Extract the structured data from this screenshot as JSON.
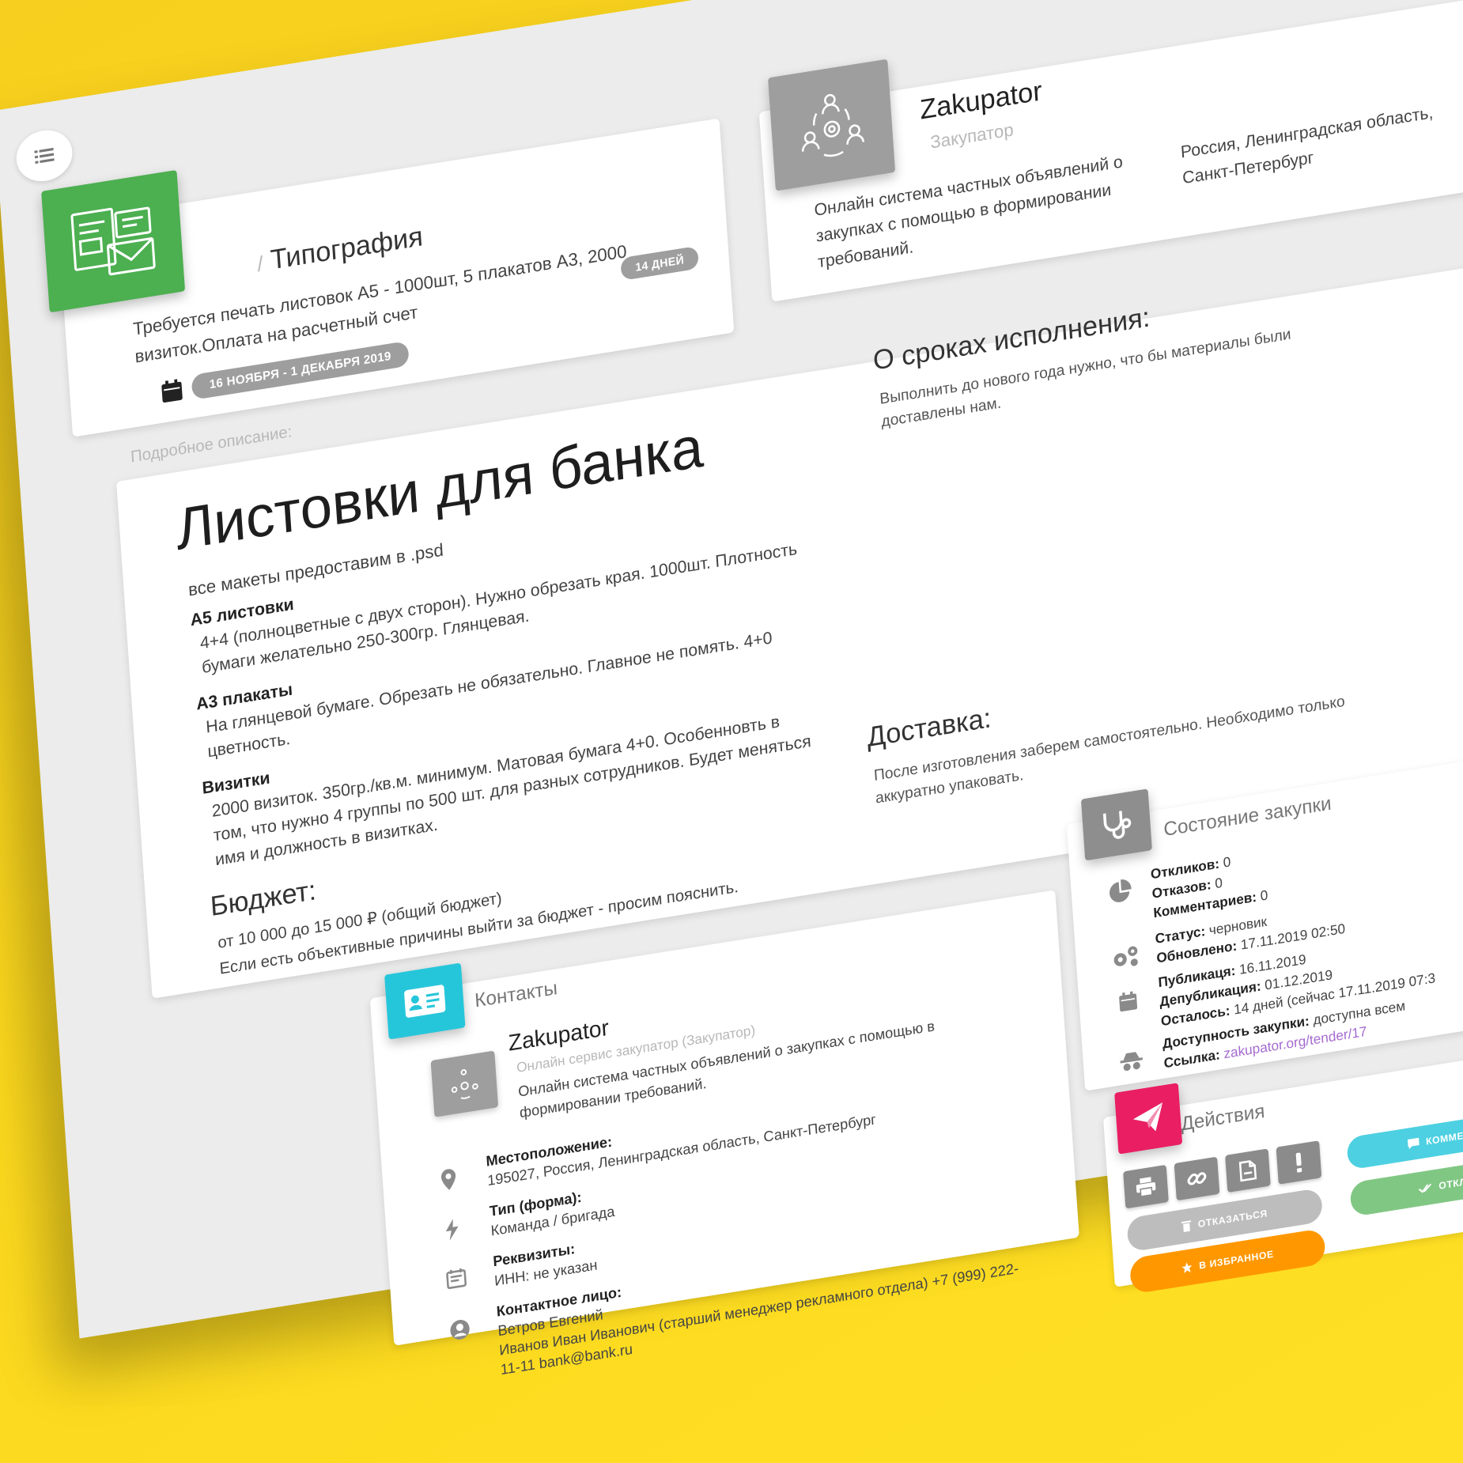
{
  "category_card": {
    "slash": "/",
    "category": "Типография",
    "description": "Требуется печать листовок А5 - 1000шт, 5 плакатов А3, 2000 визиток.Оплата на расчетный счет",
    "days_badge": "14 ДНЕЙ",
    "date_range": "16 НОЯБРЯ - 1 ДЕКАБРЯ 2019",
    "accent": "#4caf50"
  },
  "customer_card": {
    "name": "Zakupator",
    "subtitle": "Закупатор",
    "description": "Онлайн система частных объявлений о закупках с помощью в формировании требований.",
    "location_line1": "Россия, Ленинградская область,",
    "location_line2": "Санкт-Петербург"
  },
  "detail": {
    "section_label": "Подробное описание:",
    "title": "Листовки для банка",
    "intro": "все макеты предоставим в .psd",
    "items": [
      {
        "heading": "А5 листовки",
        "text": "4+4 (полноцветные с двух сторон). Нужно обрезать края. 1000шт. Плотность бумаги желательно 250-300гр. Глянцевая."
      },
      {
        "heading": "А3 плакаты",
        "text": "На глянцевой бумаге. Обрезать не обязательно. Главное не помять. 4+0 цветность."
      },
      {
        "heading": "Визитки",
        "text": "2000 визиток. 350гр./кв.м. минимум. Матовая бумага 4+0. Особенновть в том, что нужно 4 группы по 500 шт. для разных сотрудников. Будет меняться имя и должность в визитках."
      }
    ],
    "budget_heading": "Бюджет:",
    "budget_value": "от 10 000 до 15 000 ₽ (общий бюджет)",
    "budget_note": "Если есть объективные причины выйти за бюджет - просим пояснить.",
    "terms_heading": "О сроках исполнения:",
    "terms_text": "Выполнить до нового года нужно, что бы материалы были доставлены нам.",
    "delivery_heading": "Доставка:",
    "delivery_text": "После изготовления заберем самостоятельно. Необходимо только аккуратно упаковать."
  },
  "contacts": {
    "title": "Контакты",
    "org_name": "Zakupator",
    "org_subtitle": "Онлайн сервис закупатор (Закупатор)",
    "org_description": "Онлайн система частных объявлений о закупках с помощью в формировании требований.",
    "fields": [
      {
        "label": "Местоположение:",
        "value": "195027, Россия, Ленинградская область, Санкт-Петербург",
        "icon": "map-pin-icon"
      },
      {
        "label": "Тип (форма):",
        "value": "Команда / бригада",
        "icon": "bolt-icon"
      },
      {
        "label": "Реквизиты:",
        "value": "ИНН: не указан",
        "icon": "document-icon"
      },
      {
        "label": "Контактное лицо:",
        "value": "Ветров Евгений",
        "icon": "person-icon"
      }
    ],
    "contact_extra_1": "Иванов Иван Иванович (старший менеджер рекламного отдела) +7 (999) 222-",
    "contact_extra_2": "11-11 bank@bank.ru",
    "accent": "#26c6da"
  },
  "status": {
    "title": "Состояние закупки",
    "responses_label": "Откликов:",
    "responses_value": "0",
    "refusals_label": "Отказов:",
    "refusals_value": "0",
    "comments_label": "Комментариев:",
    "comments_value": "0",
    "status_label": "Статус:",
    "status_value": "черновик",
    "updated_label": "Обновлено:",
    "updated_value": "17.11.2019 02:50",
    "published_label": "Публикаця:",
    "published_value": "16.11.2019",
    "unpublished_label": "Депубликация:",
    "unpublished_value": "01.12.2019",
    "left_label": "Осталось:",
    "left_value": "14 дней (сейчас 17.11.2019 07:3",
    "access_label": "Доступность закупки:",
    "access_value": "доступна всем",
    "link_label": "Ссылка:",
    "link_value": "zakupator.org/tender/17",
    "accent": "#8e8e8e"
  },
  "actions": {
    "title": "Действия",
    "comment_label": "КОММЕН",
    "refuse_label": "ОТКАЗАТЬСЯ",
    "respond_label": "ОТКЛ",
    "favorite_label": "В ИЗБРАННОЕ",
    "accent": "#e91e63",
    "comment_color": "#4dd0e1",
    "refuse_color": "#bdbdbd",
    "respond_color": "#81c784",
    "favorite_color": "#ff9800"
  }
}
